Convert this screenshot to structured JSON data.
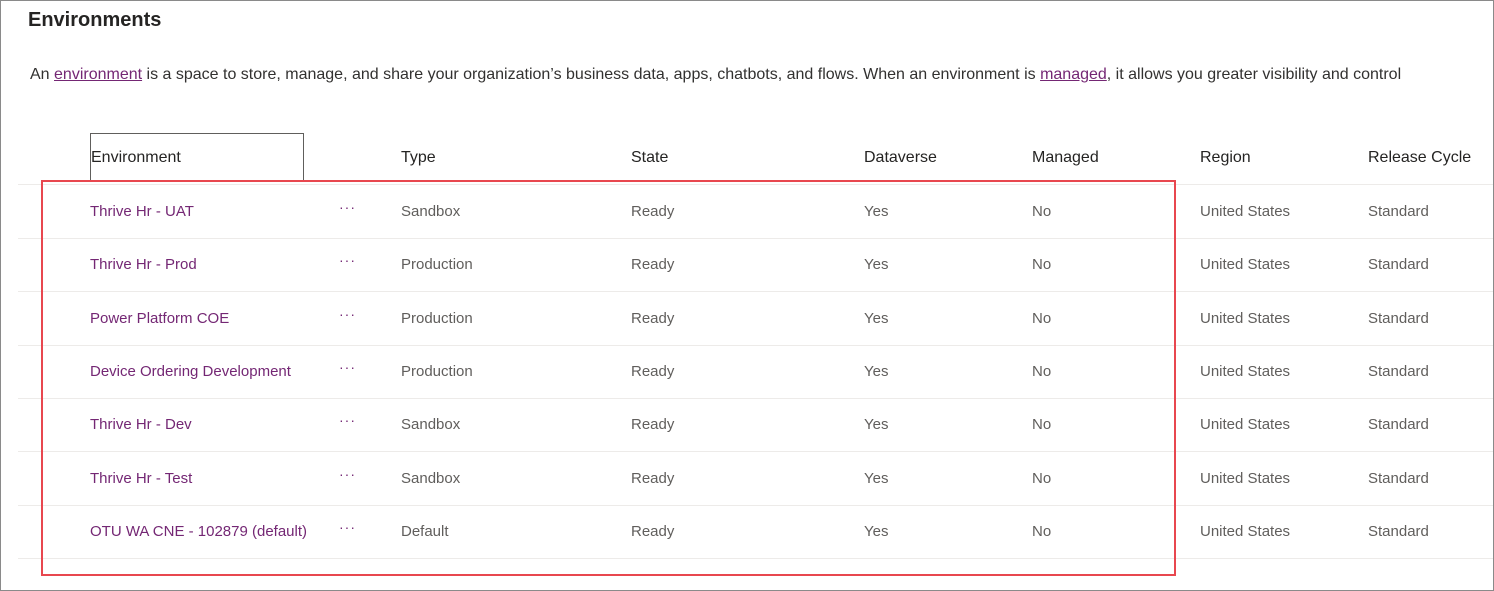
{
  "page": {
    "title": "Environments",
    "description": {
      "part1": "An ",
      "link1": "environment",
      "part2": " is a space to store, manage, and share your organization’s business data, apps, chatbots, and flows. When an environment is ",
      "link2": "managed",
      "part3": ", it allows you greater visibility and control"
    }
  },
  "table": {
    "columns": [
      "Environment",
      "Type",
      "State",
      "Dataverse",
      "Managed",
      "Region",
      "Release Cycle"
    ],
    "more_label": "···",
    "rows": [
      {
        "name": "Thrive Hr - UAT",
        "type": "Sandbox",
        "state": "Ready",
        "dataverse": "Yes",
        "managed": "No",
        "region": "United States",
        "release": "Standard"
      },
      {
        "name": "Thrive Hr - Prod",
        "type": "Production",
        "state": "Ready",
        "dataverse": "Yes",
        "managed": "No",
        "region": "United States",
        "release": "Standard"
      },
      {
        "name": "Power Platform COE",
        "type": "Production",
        "state": "Ready",
        "dataverse": "Yes",
        "managed": "No",
        "region": "United States",
        "release": "Standard"
      },
      {
        "name": "Device Ordering Development",
        "type": "Production",
        "state": "Ready",
        "dataverse": "Yes",
        "managed": "No",
        "region": "United States",
        "release": "Standard"
      },
      {
        "name": "Thrive Hr - Dev",
        "type": "Sandbox",
        "state": "Ready",
        "dataverse": "Yes",
        "managed": "No",
        "region": "United States",
        "release": "Standard"
      },
      {
        "name": "Thrive Hr - Test",
        "type": "Sandbox",
        "state": "Ready",
        "dataverse": "Yes",
        "managed": "No",
        "region": "United States",
        "release": "Standard"
      },
      {
        "name": "OTU WA CNE - 102879 (default)",
        "type": "Default",
        "state": "Ready",
        "dataverse": "Yes",
        "managed": "No",
        "region": "United States",
        "release": "Standard"
      }
    ]
  },
  "colors": {
    "link": "#742774",
    "highlight_border": "#e8474f",
    "muted_text": "#605e5c"
  }
}
